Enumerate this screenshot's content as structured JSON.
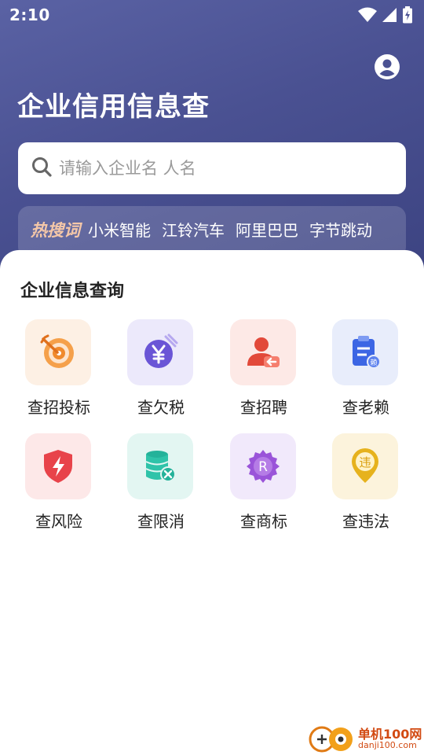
{
  "status_bar": {
    "time": "2:10"
  },
  "header": {
    "title": "企业信用信息查"
  },
  "search": {
    "placeholder": "请输入企业名 人名"
  },
  "hot_search": {
    "label": "热搜词",
    "items": [
      "小米智能",
      "江铃汽车",
      "阿里巴巴",
      "字节跳动"
    ]
  },
  "section": {
    "title": "企业信息查询"
  },
  "features": [
    {
      "label": "查招投标",
      "icon": "target-icon",
      "bg": "#fdf0e4",
      "color": "#f08a2c"
    },
    {
      "label": "查欠税",
      "icon": "yen-coin-icon",
      "bg": "#ece9fb",
      "color": "#6a55d6"
    },
    {
      "label": "查招聘",
      "icon": "user-recruit-icon",
      "bg": "#fde9e6",
      "color": "#e2493a"
    },
    {
      "label": "查老赖",
      "icon": "clipboard-icon",
      "bg": "#e8edfb",
      "color": "#3c66e4"
    },
    {
      "label": "查风险",
      "icon": "shield-lightning-icon",
      "bg": "#fde8e8",
      "color": "#e8434a"
    },
    {
      "label": "查限消",
      "icon": "database-limit-icon",
      "bg": "#e3f6f2",
      "color": "#24b29a"
    },
    {
      "label": "查商标",
      "icon": "trademark-badge-icon",
      "bg": "#f1e9fb",
      "color": "#9a54d9"
    },
    {
      "label": "查违法",
      "icon": "violation-pin-icon",
      "bg": "#fcf3dc",
      "color": "#e6b21d"
    }
  ],
  "watermark": {
    "name": "单机100网",
    "url": "danji100.com"
  },
  "colors": {
    "hero": "#4a5192",
    "hot_label": "#f4c7a8"
  }
}
